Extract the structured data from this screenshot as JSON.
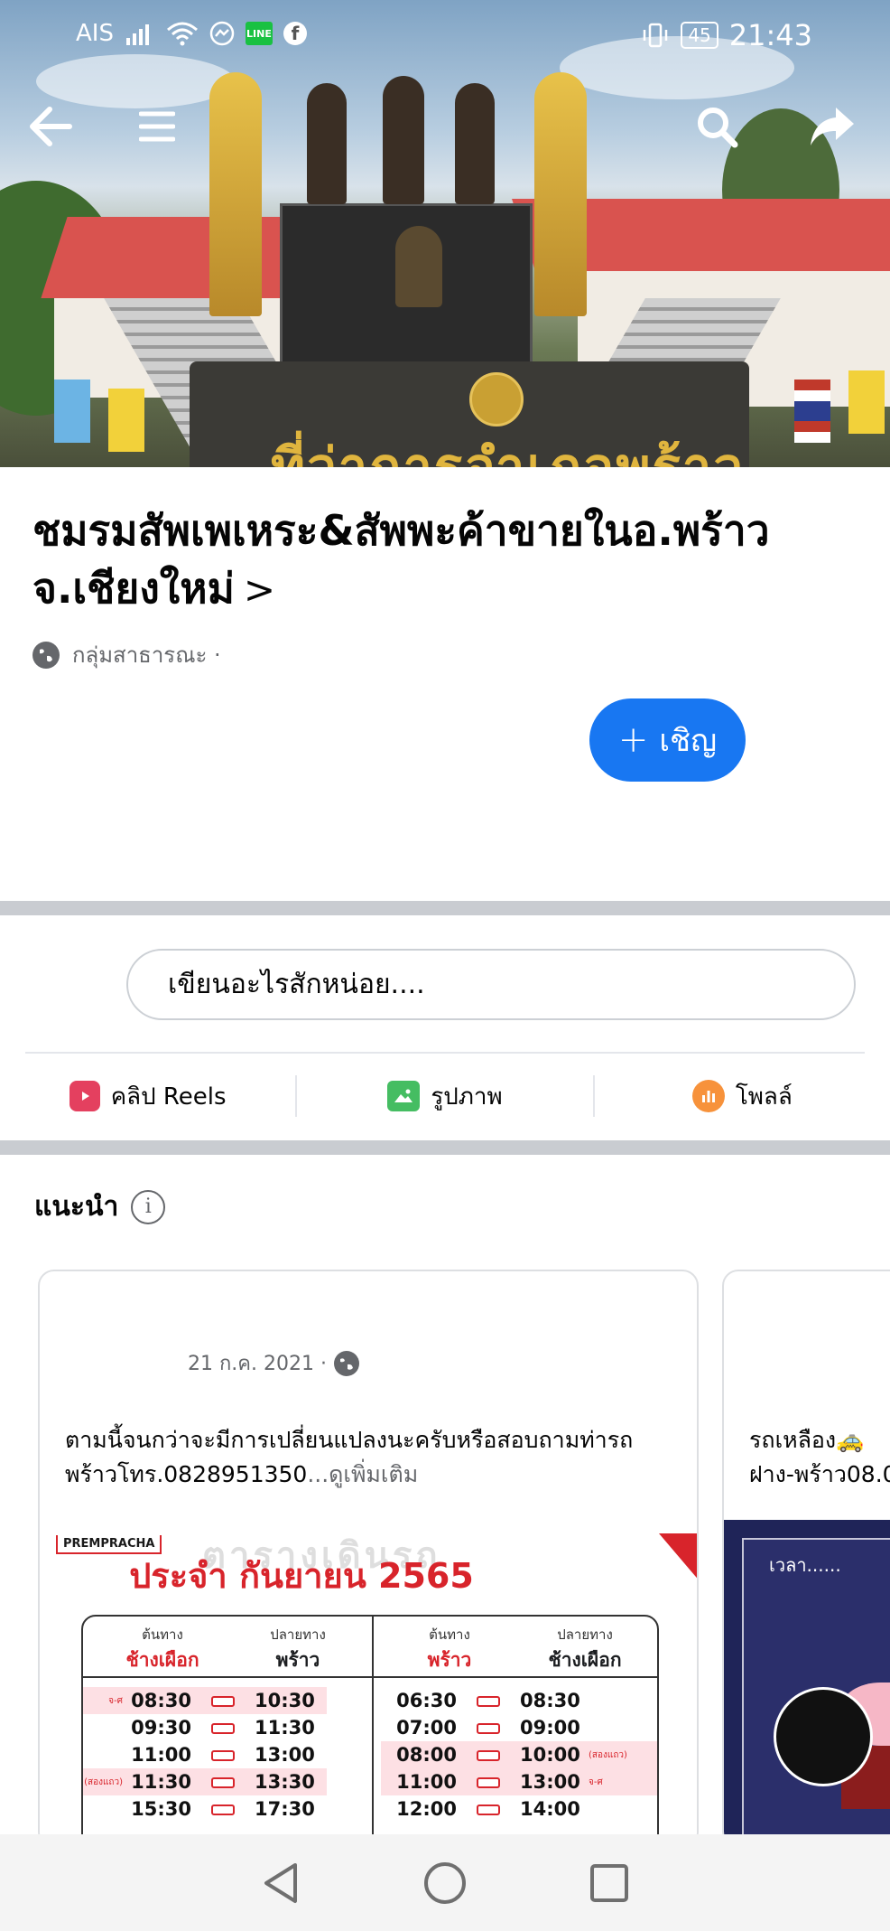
{
  "status_bar": {
    "carrier": "AIS",
    "line_badge": "LINE",
    "battery": "45",
    "time": "21:43"
  },
  "cover": {
    "sign_text": "ที่ว่าการอำเภอพร้าว"
  },
  "group": {
    "name": "ชมรมสัพเพเหระ&สัพพะค้าขายในอ.พร้าว จ.เชียงใหม่",
    "chevron": ">",
    "privacy": "กลุ่มสาธารณะ ·"
  },
  "invite": {
    "plus": "+",
    "label": "เชิญ"
  },
  "composer": {
    "placeholder": "เขียนอะไรสักหน่อย....",
    "actions": [
      {
        "label": "คลิป Reels",
        "icon": "reels-icon",
        "color": "#e4405f"
      },
      {
        "label": "รูปภาพ",
        "icon": "photo-icon",
        "color": "#45bd62"
      },
      {
        "label": "โพลล์",
        "icon": "poll-icon",
        "color": "#f7923b"
      }
    ]
  },
  "suggested": {
    "title": "แนะนำ",
    "info": "i"
  },
  "cards": [
    {
      "date": "21 ก.ค. 2021 ·",
      "text": "ตามนี้จนกว่าจะมีการเปลี่ยนแปลงนะครับหรือสอบถามท่ารถพร้าวโทร.0828951350",
      "more": "...ดูเพิ่มเติม",
      "image": {
        "brand": "PREMPRACHA",
        "title": "ประจำ กันยายน 2565",
        "cols": [
          {
            "sub": "ต้นทาง",
            "main": "ช้างเผือก"
          },
          {
            "sub": "ปลายทาง",
            "main": "พร้าว"
          },
          {
            "sub": "ต้นทาง",
            "main": "พร้าว"
          },
          {
            "sub": "ปลายทาง",
            "main": "ช้างเผือก"
          }
        ],
        "left_rows": [
          {
            "dep": "08:30",
            "arr": "10:30",
            "tag": "จ-ศ",
            "highlight": true
          },
          {
            "dep": "09:30",
            "arr": "11:30",
            "tag": "",
            "highlight": false
          },
          {
            "dep": "11:00",
            "arr": "13:00",
            "tag": "",
            "highlight": false
          },
          {
            "dep": "11:30",
            "arr": "13:30",
            "tag": "(สองแถว)",
            "highlight": true
          },
          {
            "dep": "15:30",
            "arr": "17:30",
            "tag": "",
            "highlight": false
          }
        ],
        "right_rows": [
          {
            "dep": "06:30",
            "arr": "08:30",
            "tag": "",
            "highlight": false
          },
          {
            "dep": "07:00",
            "arr": "09:00",
            "tag": "",
            "highlight": false
          },
          {
            "dep": "08:00",
            "arr": "10:00",
            "tag": "(สองแถว)",
            "highlight": true
          },
          {
            "dep": "11:00",
            "arr": "13:00",
            "tag": "จ-ศ",
            "highlight": true
          },
          {
            "dep": "12:00",
            "arr": "14:00",
            "tag": "",
            "highlight": false
          }
        ]
      }
    },
    {
      "text_line1": "รถเหลือง🚕",
      "text_line2": "ฝาง-พร้าว08.0",
      "image_text": "เวลา......"
    }
  ],
  "colors": {
    "brand_blue": "#1877f2",
    "divider_gray": "#c9ccd1",
    "text_secondary": "#65676b"
  }
}
